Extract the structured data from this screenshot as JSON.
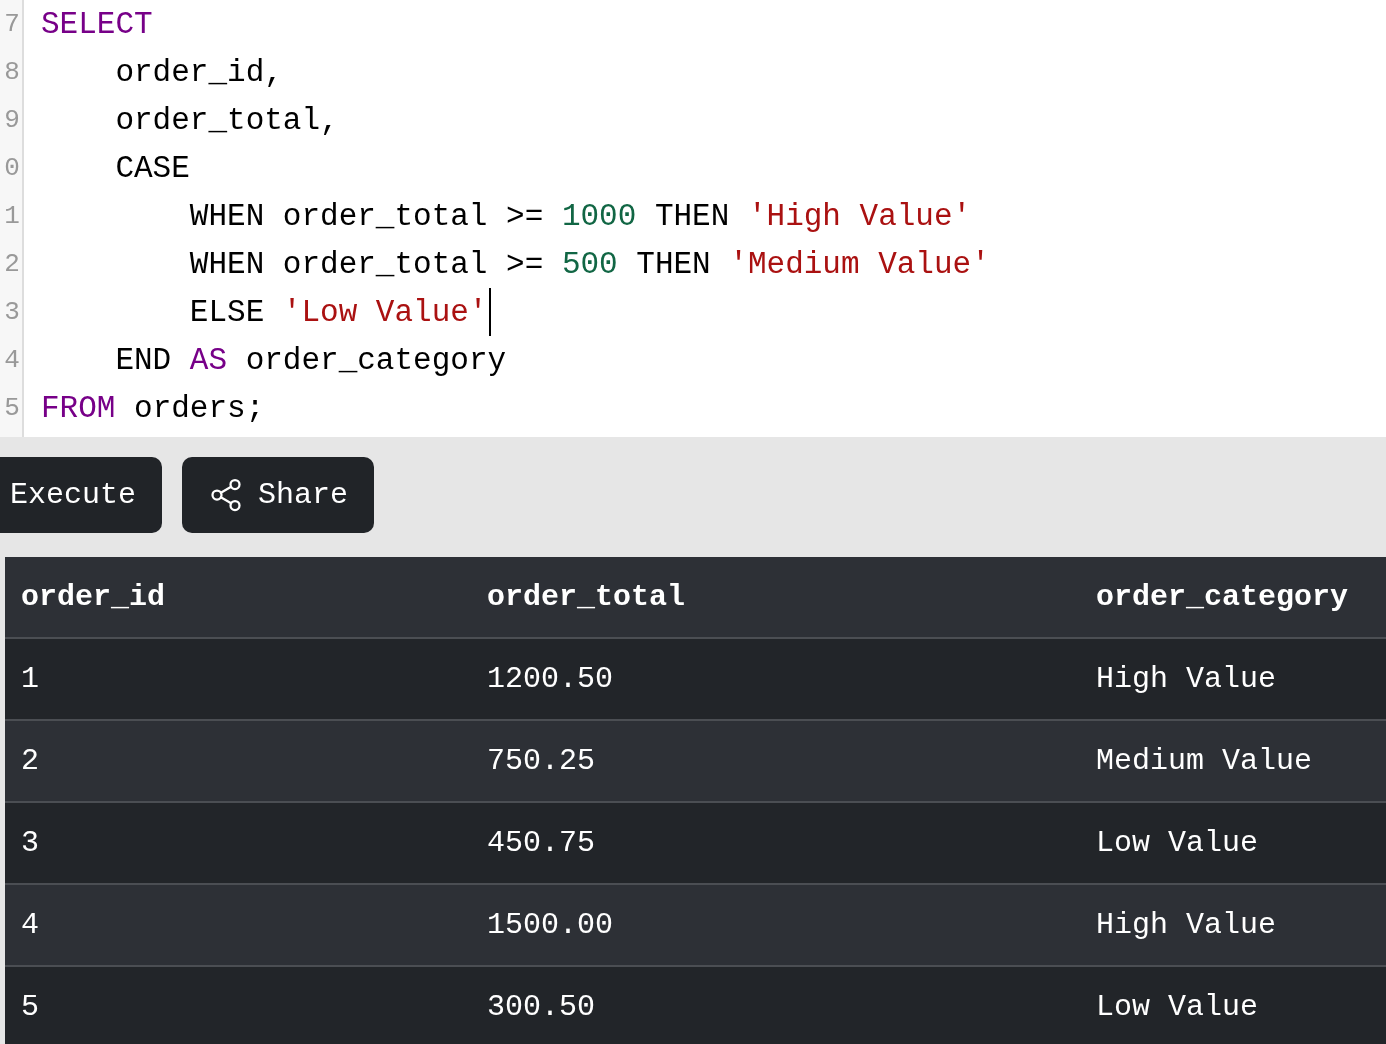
{
  "editor": {
    "lines": [
      {
        "number": "7",
        "tokens": [
          {
            "kind": "keyword",
            "text": "SELECT"
          }
        ]
      },
      {
        "number": "8",
        "tokens": [
          {
            "kind": "plain",
            "text": "    order_id,"
          }
        ]
      },
      {
        "number": "9",
        "tokens": [
          {
            "kind": "plain",
            "text": "    order_total,"
          }
        ]
      },
      {
        "number": "0",
        "tokens": [
          {
            "kind": "plain",
            "text": "    CASE"
          }
        ]
      },
      {
        "number": "1",
        "tokens": [
          {
            "kind": "plain",
            "text": "        WHEN order_total >= "
          },
          {
            "kind": "number",
            "text": "1000"
          },
          {
            "kind": "plain",
            "text": " THEN "
          },
          {
            "kind": "string",
            "text": "'High Value'"
          }
        ]
      },
      {
        "number": "2",
        "tokens": [
          {
            "kind": "plain",
            "text": "        WHEN order_total >= "
          },
          {
            "kind": "number",
            "text": "500"
          },
          {
            "kind": "plain",
            "text": " THEN "
          },
          {
            "kind": "string",
            "text": "'Medium Value'"
          }
        ]
      },
      {
        "number": "3",
        "cursor": true,
        "tokens": [
          {
            "kind": "plain",
            "text": "        ELSE "
          },
          {
            "kind": "string",
            "text": "'Low Value'"
          }
        ]
      },
      {
        "number": "4",
        "tokens": [
          {
            "kind": "plain",
            "text": "    END "
          },
          {
            "kind": "keyword",
            "text": "AS"
          },
          {
            "kind": "plain",
            "text": " order_category"
          }
        ]
      },
      {
        "number": "5",
        "tokens": [
          {
            "kind": "keyword",
            "text": "FROM"
          },
          {
            "kind": "plain",
            "text": " orders;"
          }
        ]
      }
    ]
  },
  "buttons": [
    {
      "kind": "execute",
      "label": "Execute"
    },
    {
      "kind": "share",
      "label": "Share"
    }
  ],
  "table": {
    "columns": [
      "order_id",
      "order_total",
      "order_category"
    ],
    "rows": [
      [
        "1",
        "1200.50",
        "High Value"
      ],
      [
        "2",
        "750.25",
        "Medium Value"
      ],
      [
        "3",
        "450.75",
        "Low Value"
      ],
      [
        "4",
        "1500.00",
        "High Value"
      ],
      [
        "5",
        "300.50",
        "Low Value"
      ]
    ]
  }
}
